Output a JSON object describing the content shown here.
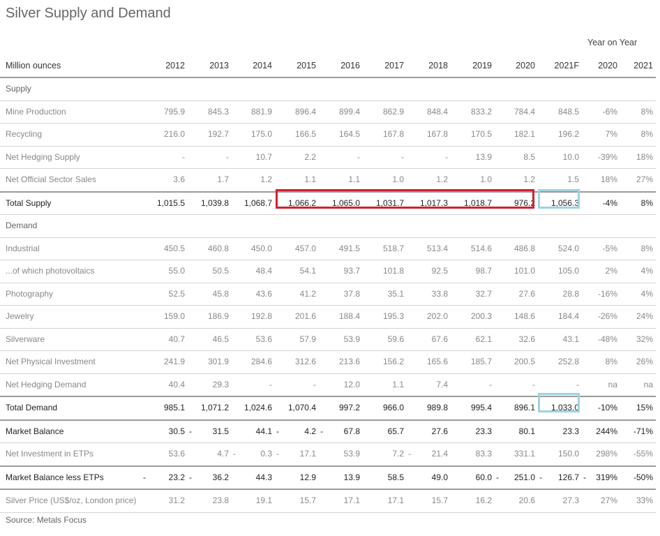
{
  "title": "Silver Supply and Demand",
  "yoy_label": "Year on Year",
  "header": {
    "label": "Million ounces",
    "cols": [
      "2012",
      "2013",
      "2014",
      "2015",
      "2016",
      "2017",
      "2018",
      "2019",
      "2020",
      "2021F",
      "2020",
      "2021"
    ]
  },
  "rows": [
    {
      "label": "Supply",
      "type": "section",
      "values": []
    },
    {
      "label": "Mine Production",
      "type": "normal",
      "values": [
        "795.9",
        "845.3",
        "881.9",
        "896.4",
        "899.4",
        "862.9",
        "848.4",
        "833.2",
        "784.4",
        "848.5",
        "-6%",
        "8%"
      ]
    },
    {
      "label": "Recycling",
      "type": "normal",
      "values": [
        "216.0",
        "192.7",
        "175.0",
        "166.5",
        "164.5",
        "167.8",
        "167.8",
        "170.5",
        "182.1",
        "196.2",
        "7%",
        "8%"
      ]
    },
    {
      "label": "Net Hedging Supply",
      "type": "normal",
      "values": [
        "-",
        "-",
        "10.7",
        "2.2",
        "-",
        "-",
        "-",
        "13.9",
        "8.5",
        "10.0",
        "-39%",
        "18%"
      ]
    },
    {
      "label": "Net Official Sector Sales",
      "type": "normal",
      "values": [
        "3.6",
        "1.7",
        "1.2",
        "1.1",
        "1.1",
        "1.0",
        "1.2",
        "1.0",
        "1.2",
        "1.5",
        "18%",
        "27%"
      ]
    },
    {
      "label": "Total Supply",
      "type": "bold",
      "values": [
        "1,015.5",
        "1,039.8",
        "1,068.7",
        "1,066.2",
        "1,065.0",
        "1,031.7",
        "1,017.3",
        "1,018.7",
        "976.2",
        "1,056.3",
        "-4%",
        "8%"
      ]
    },
    {
      "label": "Demand",
      "type": "section",
      "values": []
    },
    {
      "label": "Industrial",
      "type": "normal",
      "values": [
        "450.5",
        "460.8",
        "450.0",
        "457.0",
        "491.5",
        "518.7",
        "513.4",
        "514.6",
        "486.8",
        "524.0",
        "-5%",
        "8%"
      ]
    },
    {
      "label": "...of which photovoltaics",
      "type": "normal",
      "values": [
        "55.0",
        "50.5",
        "48.4",
        "54.1",
        "93.7",
        "101.8",
        "92.5",
        "98.7",
        "101.0",
        "105.0",
        "2%",
        "4%"
      ]
    },
    {
      "label": "Photography",
      "type": "normal",
      "values": [
        "52.5",
        "45.8",
        "43.6",
        "41.2",
        "37.8",
        "35.1",
        "33.8",
        "32.7",
        "27.6",
        "28.8",
        "-16%",
        "4%"
      ]
    },
    {
      "label": "Jewelry",
      "type": "normal",
      "values": [
        "159.0",
        "186.9",
        "192.8",
        "201.6",
        "188.4",
        "195.3",
        "202.0",
        "200.3",
        "148.6",
        "184.4",
        "-26%",
        "24%"
      ]
    },
    {
      "label": "Silverware",
      "type": "normal",
      "values": [
        "40.7",
        "46.5",
        "53.6",
        "57.9",
        "53.9",
        "59.6",
        "67.6",
        "62.1",
        "32.6",
        "43.1",
        "-48%",
        "32%"
      ]
    },
    {
      "label": "Net Physical Investment",
      "type": "normal",
      "values": [
        "241.9",
        "301.9",
        "284.6",
        "312.6",
        "213.6",
        "156.2",
        "165.6",
        "185.7",
        "200.5",
        "252.8",
        "8%",
        "26%"
      ]
    },
    {
      "label": "Net Hedging Demand",
      "type": "normal",
      "values": [
        "40.4",
        "29.3",
        "-",
        "-",
        "12.0",
        "1.1",
        "7.4",
        "-",
        "-",
        "-",
        "na",
        "na"
      ]
    },
    {
      "label": "Total Demand",
      "type": "bold",
      "values": [
        "985.1",
        "1,071.2",
        "1,024.6",
        "1,070.4",
        "997.2",
        "966.0",
        "989.8",
        "995.4",
        "896.1",
        "1,033.0",
        "-10%",
        "15%"
      ]
    },
    {
      "label": "Market Balance",
      "type": "section-strong",
      "values": [
        "30.5",
        "31.5",
        "44.1",
        "4.2",
        "67.8",
        "65.7",
        "27.6",
        "23.3",
        "80.1",
        "23.3",
        "244%",
        "-71%"
      ]
    },
    {
      "label": "Net Investment in ETPs",
      "type": "normal",
      "values": [
        "53.6",
        "4.7",
        "0.3",
        "17.1",
        "53.9",
        "7.2",
        "21.4",
        "83.3",
        "331.1",
        "150.0",
        "298%",
        "-55%"
      ]
    },
    {
      "label": "Market Balance less ETPs",
      "type": "section-strong",
      "values": [
        "23.2",
        "36.2",
        "44.3",
        "12.9",
        "13.9",
        "58.5",
        "49.0",
        "60.0",
        "251.0",
        "126.7",
        "319%",
        "-50%"
      ]
    },
    {
      "label": "Silver Price (US$/oz, London price)",
      "type": "normal",
      "values": [
        "31.2",
        "23.8",
        "19.1",
        "15.7",
        "17.1",
        "17.1",
        "15.7",
        "16.2",
        "20.6",
        "27.3",
        "27%",
        "33%"
      ]
    }
  ],
  "dashes": {
    "market_balance": [
      "-",
      "-",
      "-"
    ],
    "net_investment": [
      "-",
      "-",
      "-"
    ],
    "market_balance_less": [
      "-",
      "-",
      "-",
      "-",
      "-"
    ]
  },
  "source": "Source: Metals Focus",
  "colors": {
    "highlight_red": "#d0212f",
    "highlight_blue": "#9fd3e0"
  }
}
